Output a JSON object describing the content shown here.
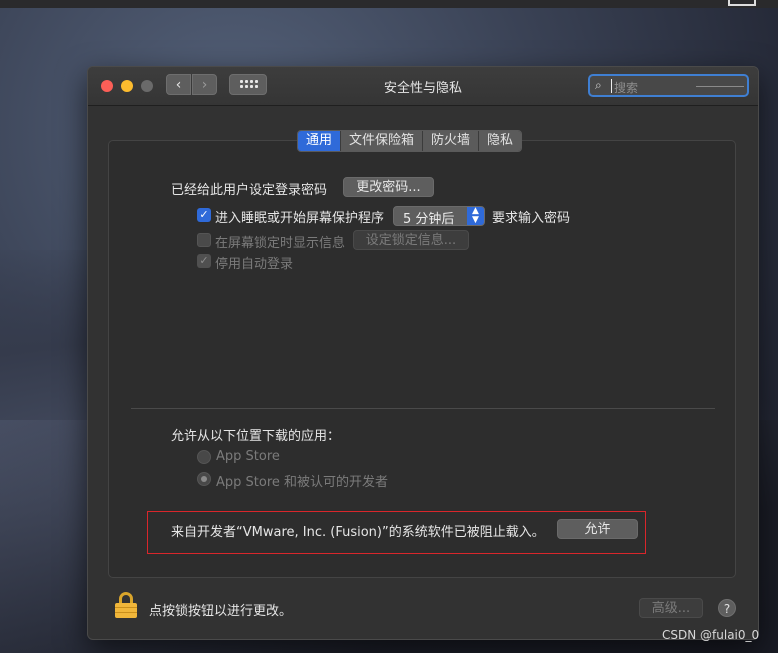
{
  "window": {
    "title": "安全性与隐私",
    "nav_back": "‹",
    "nav_forward": "›",
    "search_placeholder": "搜索",
    "search_icon": "search-icon"
  },
  "tabs": [
    {
      "label": "通用",
      "active": true
    },
    {
      "label": "文件保险箱",
      "active": false
    },
    {
      "label": "防火墙",
      "active": false
    },
    {
      "label": "隐私",
      "active": false
    }
  ],
  "general": {
    "password_set_label": "已经给此用户设定登录密码",
    "change_password_button": "更改密码...",
    "require_password_checkbox": {
      "label": "进入睡眠或开始屏幕保护程序",
      "checked": true
    },
    "require_password_delay": "5 分钟后",
    "require_password_suffix": "要求输入密码",
    "show_message_checkbox": {
      "label": "在屏幕锁定时显示信息",
      "checked": false,
      "enabled": false
    },
    "set_lock_message_button": "设定锁定信息...",
    "disable_autologin_checkbox": {
      "label": "停用自动登录",
      "checked": true,
      "enabled": false
    }
  },
  "downloads": {
    "heading": "允许从以下位置下载的应用：",
    "options": [
      {
        "label": "App Store",
        "selected": false
      },
      {
        "label": "App Store 和被认可的开发者",
        "selected": true
      }
    ]
  },
  "blocked_notice": {
    "text": "来自开发者“VMware, Inc. (Fusion)”的系统软件已被阻止载入。",
    "allow_button": "允许",
    "highlight_color": "#d9262b"
  },
  "footer": {
    "lock_text": "点按锁按钮以进行更改。",
    "advanced_button": "高级...",
    "help_button": "?"
  },
  "watermark": "CSDN @fulai0_0",
  "colors": {
    "accent": "#2f6ad9",
    "close": "#fc5f57",
    "minimize": "#fdbc2e"
  }
}
